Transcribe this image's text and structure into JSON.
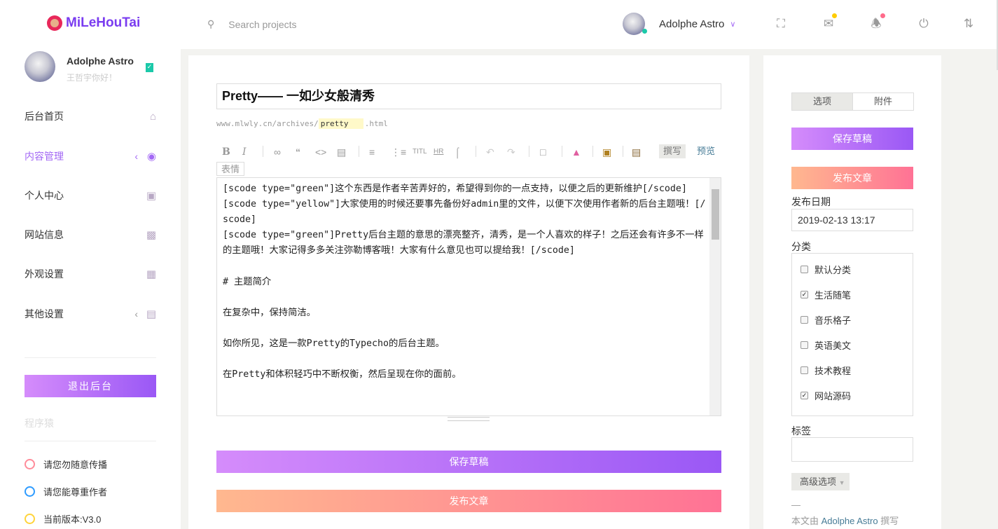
{
  "header": {
    "logo": "MiLeHouTai",
    "search_placeholder": "Search projects",
    "user_name": "Adolphe Astro",
    "status_color": "#1bc9a9",
    "mail_dot": "#ffcc00",
    "bell_dot": "#ff6b8b"
  },
  "sidebar": {
    "user_name": "Adolphe Astro",
    "greeting": "王哲宇你好！",
    "items": [
      {
        "label": "后台首页",
        "icon": "home-icon"
      },
      {
        "label": "内容管理",
        "icon": "target-icon",
        "active": true
      },
      {
        "label": "个人中心",
        "icon": "contact-icon"
      },
      {
        "label": "网站信息",
        "icon": "bar-chart-icon"
      },
      {
        "label": "外观设置",
        "icon": "grid-icon"
      },
      {
        "label": "其他设置",
        "icon": "toolbox-icon"
      }
    ],
    "logout": "退出后台",
    "section": "程序猿",
    "notes": [
      {
        "text": "请您勿随意传播",
        "color": "#ff8c9a"
      },
      {
        "text": "请您能尊重作者",
        "color": "#2e9bff"
      },
      {
        "text": "当前版本:V3.0",
        "color": "#ffd43b"
      }
    ]
  },
  "editor": {
    "title": "Pretty—— 一如少女般清秀",
    "url_prefix": "www.mlwly.cn/archives/",
    "slug": "pretty",
    "url_suffix": ".html",
    "tabs": {
      "write": "撰写",
      "preview": "预览",
      "emoji": "表情"
    },
    "content": "[scode type=\"green\"]这个东西是作者辛苦弄好的，希望得到你的一点支持，以便之后的更新维护[/scode]\n[scode type=\"yellow\"]大家使用的时候还要事先备份好admin里的文件，以便下次使用作者新的后台主题哦！[/scode]\n[scode type=\"green\"]Pretty后台主题的意思的漂亮整齐，清秀，是一个人喜欢的样子！之后还会有许多不一样的主题哦！大家记得多多关注弥勒博客哦！大家有什么意见也可以提给我！[/scode]\n\n# 主题简介\n\n在复杂中，保持简洁。\n\n如你所见，这是一款Pretty的Typecho的后台主题。\n\n在Pretty和体积轻巧中不断权衡，然后呈现在你的面前。",
    "save": "保存草稿",
    "publish": "发布文章"
  },
  "panel": {
    "tab_options": "选项",
    "tab_attach": "附件",
    "save": "保存草稿",
    "publish": "发布文章",
    "date_label": "发布日期",
    "date": "2019-02-13 13:17",
    "category_label": "分类",
    "categories": [
      {
        "name": "默认分类",
        "checked": false
      },
      {
        "name": "生活随笔",
        "checked": true
      },
      {
        "name": "音乐格子",
        "checked": false
      },
      {
        "name": "英语美文",
        "checked": false
      },
      {
        "name": "技术教程",
        "checked": false
      },
      {
        "name": "网站源码",
        "checked": true
      }
    ],
    "tags_label": "标签",
    "advanced": "高级选项",
    "dash": "—",
    "author_prefix": "本文由",
    "author": "Adolphe Astro",
    "author_suffix": "撰写"
  }
}
